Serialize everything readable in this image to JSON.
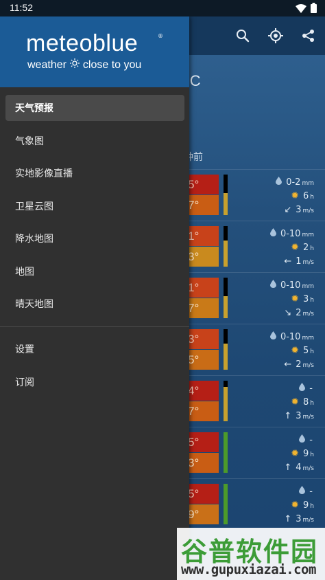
{
  "status_bar": {
    "time": "11:52"
  },
  "app_bar": {
    "icons": [
      "search-icon",
      "locate-icon",
      "share-icon"
    ]
  },
  "background": {
    "temp_unit": "°C",
    "updated_suffix": "钟前",
    "days": [
      {
        "max": "5°",
        "min": "7°",
        "rain": "0-2",
        "rain_unit": "mm",
        "sun": "6",
        "sun_unit": "h",
        "wind": "3",
        "wind_unit": "m/s",
        "wind_dir": "↙",
        "meter_color": "#c8a12e",
        "meter_top_fraction": 0.45,
        "max_bg": "#b51f16",
        "min_bg": "#c95d14"
      },
      {
        "max": "1°",
        "min": "3°",
        "rain": "0-10",
        "rain_unit": "mm",
        "sun": "2",
        "sun_unit": "h",
        "wind": "1",
        "wind_unit": "m/s",
        "wind_dir": "←",
        "meter_color": "#c8a12e",
        "meter_top_fraction": 0.35,
        "max_bg": "#c8421a",
        "min_bg": "#c98a1e"
      },
      {
        "max": "1°",
        "min": "7°",
        "rain": "0-10",
        "rain_unit": "mm",
        "sun": "3",
        "sun_unit": "h",
        "wind": "2",
        "wind_unit": "m/s",
        "wind_dir": "↘",
        "meter_color": "#c8a12e",
        "meter_top_fraction": 0.45,
        "max_bg": "#c8421a",
        "min_bg": "#c97a18"
      },
      {
        "max": "3°",
        "min": "5°",
        "rain": "0-10",
        "rain_unit": "mm",
        "sun": "5",
        "sun_unit": "h",
        "wind": "2",
        "wind_unit": "m/s",
        "wind_dir": "←",
        "meter_color": "#c8a12e",
        "meter_top_fraction": 0.35,
        "max_bg": "#c8421a",
        "min_bg": "#c96c16"
      },
      {
        "max": "4°",
        "min": "7°",
        "rain": "-",
        "rain_unit": "",
        "sun": "8",
        "sun_unit": "h",
        "wind": "3",
        "wind_unit": "m/s",
        "wind_dir": "↑",
        "meter_color": "#c8a12e",
        "meter_top_fraction": 0.15,
        "max_bg": "#b51f16",
        "min_bg": "#c95d14"
      },
      {
        "max": "5°",
        "min": "3°",
        "rain": "-",
        "rain_unit": "",
        "sun": "9",
        "sun_unit": "h",
        "wind": "4",
        "wind_unit": "m/s",
        "wind_dir": "↑",
        "meter_color": "#4c9a2a",
        "meter_top_fraction": 0.0,
        "max_bg": "#b51f16",
        "min_bg": "#c95d14"
      },
      {
        "max": "5°",
        "min": "9°",
        "rain": "-",
        "rain_unit": "",
        "sun": "9",
        "sun_unit": "h",
        "wind": "3",
        "wind_unit": "m/s",
        "wind_dir": "↑",
        "meter_color": "#4c9a2a",
        "meter_top_fraction": 0.0,
        "max_bg": "#b51f16",
        "min_bg": "#c97018"
      }
    ]
  },
  "drawer": {
    "brand_name": "meteoblue",
    "brand_reg": "®",
    "brand_tag_left": "weather",
    "brand_tag_right": "close to you",
    "menu_items": [
      {
        "label": "天气预报",
        "active": true
      },
      {
        "label": "气象图",
        "active": false
      },
      {
        "label": "实地影像直播",
        "active": false
      },
      {
        "label": "卫星云图",
        "active": false
      },
      {
        "label": "降水地图",
        "active": false
      },
      {
        "label": "地图",
        "active": false
      },
      {
        "label": "晴天地图",
        "active": false
      }
    ],
    "secondary_items": [
      {
        "label": "设置"
      },
      {
        "label": "订阅"
      }
    ]
  },
  "watermark": {
    "title": "谷普软件园",
    "url": "www.gupuxiazai.com"
  }
}
